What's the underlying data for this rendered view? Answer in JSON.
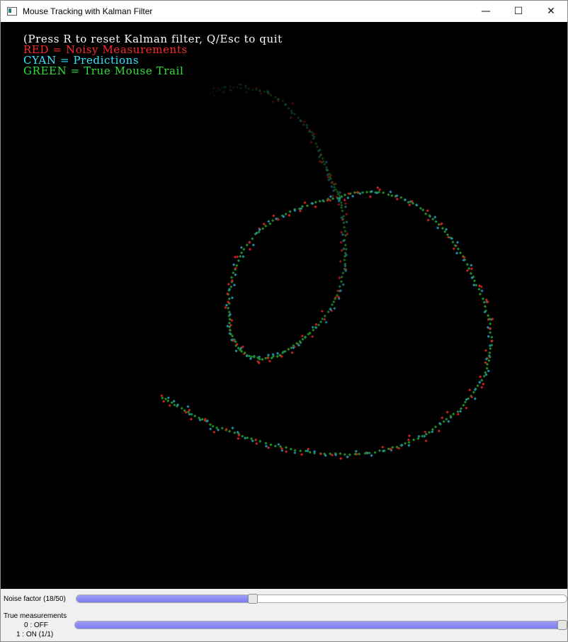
{
  "window": {
    "title": "Mouse Tracking with Kalman Filter",
    "controls": {
      "minimize": "—",
      "maximize": "☐",
      "close": "✕"
    }
  },
  "overlay": {
    "lines": [
      {
        "text": "(Press R to reset Kalman filter, Q/Esc to quit",
        "color": "#ffffff"
      },
      {
        "text": "RED = Noisy Measurements",
        "color": "#ff2a2a"
      },
      {
        "text": "CYAN = Predictions",
        "color": "#35e6ff"
      },
      {
        "text": "GREEN = True Mouse Trail",
        "color": "#2fe03a"
      }
    ]
  },
  "colors": {
    "measurement": "#c21f1f",
    "prediction": "#1f8aa6",
    "truth": "#1f8a25"
  },
  "trackbars": {
    "noise": {
      "label": "Noise factor (18/50)",
      "value": 18,
      "max": 50
    },
    "true_measurements": {
      "label": "True measurements",
      "options": [
        "0 : OFF",
        "1 : ON (1/1)"
      ],
      "value": 1,
      "max": 1
    }
  }
}
